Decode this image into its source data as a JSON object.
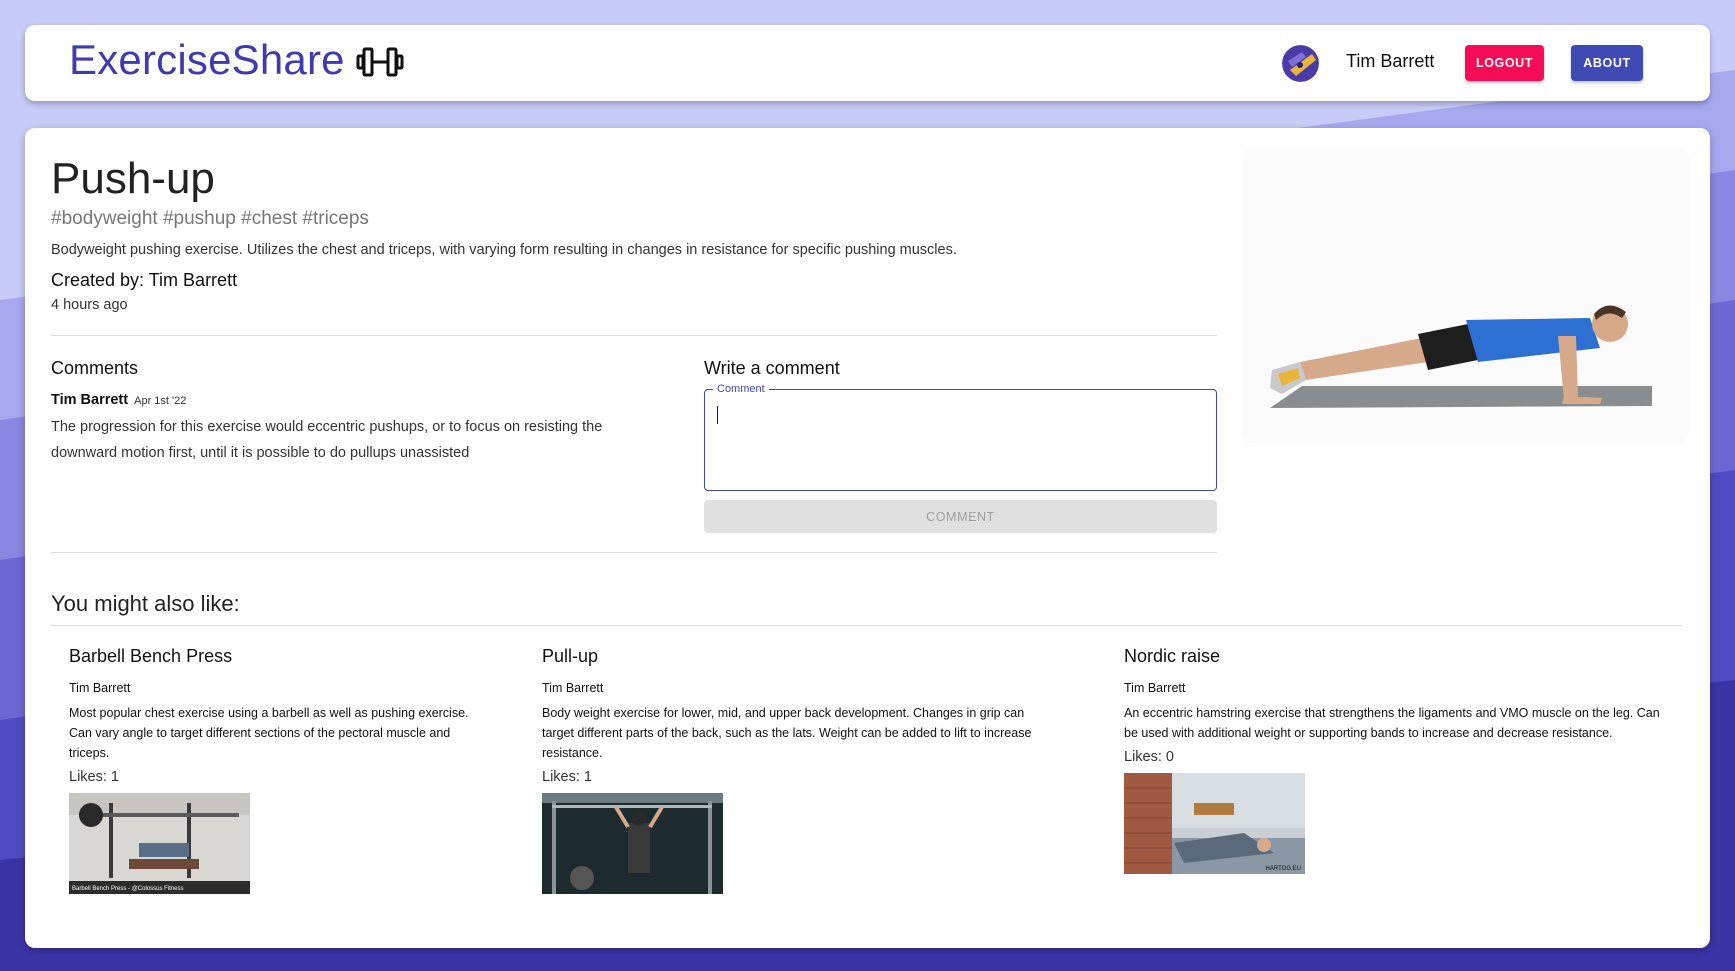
{
  "header": {
    "brand": "ExerciseShare",
    "user_name": "Tim Barrett",
    "logout_label": "LOGOUT",
    "about_label": "ABOUT"
  },
  "exercise": {
    "title": "Push-up",
    "tags": "#bodyweight #pushup #chest #triceps",
    "description": "Bodyweight pushing exercise. Utilizes the chest and triceps, with varying form resulting in changes in resistance for specific pushing muscles.",
    "created_by": "Created by: Tim Barrett",
    "time_ago": "4 hours ago"
  },
  "comments": {
    "heading": "Comments",
    "items": [
      {
        "author": "Tim Barrett",
        "date": "Apr 1st '22",
        "text": "The progression for this exercise would eccentric pushups, or to focus on resisting the downward motion first, until it is possible to do pullups unassisted"
      }
    ]
  },
  "write_comment": {
    "heading": "Write a comment",
    "field_label": "Comment",
    "value": "",
    "button_label": "COMMENT"
  },
  "recommendations": {
    "heading": "You might also like:",
    "items": [
      {
        "title": "Barbell Bench Press",
        "author": "Tim Barrett",
        "description": "Most popular chest exercise using a barbell as well as pushing exercise. Can vary angle to target different sections of the pectoral muscle and triceps.",
        "likes": "Likes: 1",
        "thumb_caption": "Barbell Bench Press - @Colossus Fitness"
      },
      {
        "title": "Pull-up",
        "author": "Tim Barrett",
        "description": "Body weight exercise for lower, mid, and upper back development. Changes in grip can target different parts of the back, such as the lats. Weight can be added to lift to increase resistance.",
        "likes": "Likes: 1"
      },
      {
        "title": "Nordic raise",
        "author": "Tim Barrett",
        "description": "An eccentric hamstring exercise that strengthens the ligaments and VMO muscle on the leg. Can be used with additional weight or supporting bands to increase and decrease resistance.",
        "likes": "Likes: 0",
        "thumb_caption": "HARTOG.EU"
      }
    ]
  },
  "colors": {
    "brand": "#3e3ab0",
    "logout": "#f50c57",
    "about": "#3f4ab4",
    "background_top": "#c8caf8",
    "background_bottom": "#3b34a6"
  },
  "icons": [
    "dumbbell-icon",
    "avatar"
  ]
}
